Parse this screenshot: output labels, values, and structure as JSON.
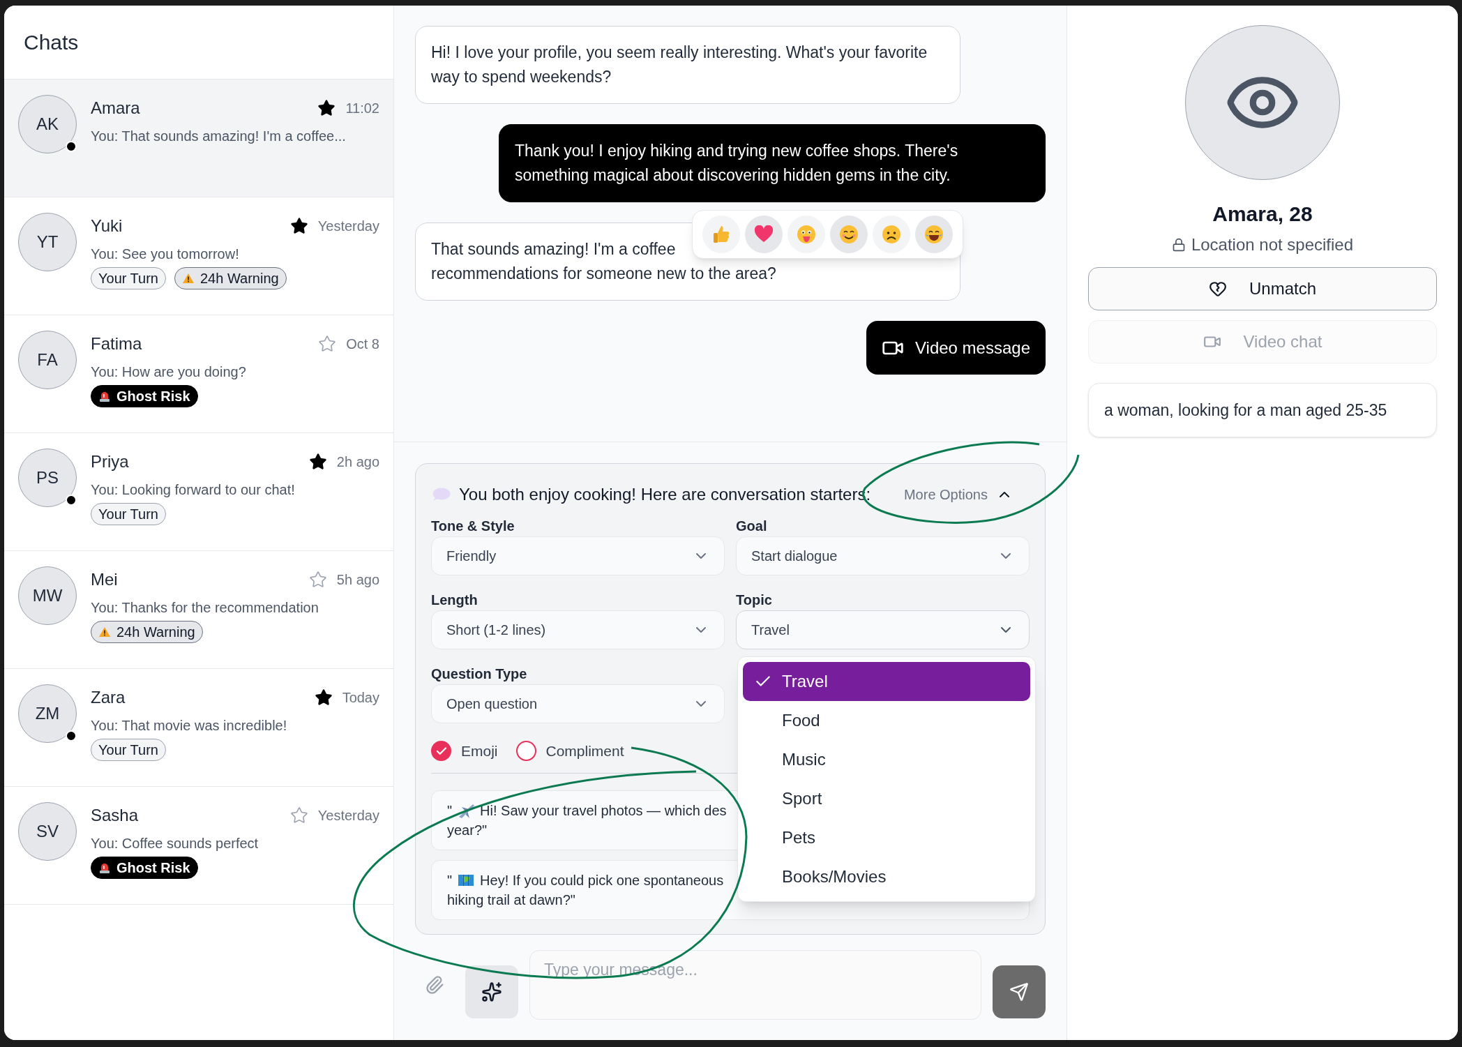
{
  "sidebar": {
    "title": "Chats",
    "chats": [
      {
        "initials": "AK",
        "name": "Amara",
        "time": "11:02",
        "preview": "You: That sounds amazing! I'm a coffee...",
        "starred": true,
        "online": true,
        "selected": true
      },
      {
        "initials": "YT",
        "name": "Yuki",
        "time": "Yesterday",
        "preview": "You: See you tomorrow!",
        "starred": true,
        "online": false,
        "selected": false,
        "badges": [
          {
            "kind": "turn",
            "label": "Your Turn"
          },
          {
            "kind": "warning",
            "label": "24h Warning"
          }
        ]
      },
      {
        "initials": "FA",
        "name": "Fatima",
        "time": "Oct 8",
        "preview": "You: How are you doing?",
        "starred": false,
        "online": false,
        "selected": false,
        "badges": [
          {
            "kind": "ghost",
            "label": "Ghost Risk"
          }
        ]
      },
      {
        "initials": "PS",
        "name": "Priya",
        "time": "2h ago",
        "preview": "You: Looking forward to our chat!",
        "starred": true,
        "online": true,
        "selected": false,
        "badges": [
          {
            "kind": "turn",
            "label": "Your Turn"
          }
        ]
      },
      {
        "initials": "MW",
        "name": "Mei",
        "time": "5h ago",
        "preview": "You: Thanks for the recommendation",
        "starred": false,
        "online": false,
        "selected": false,
        "badges": [
          {
            "kind": "warning",
            "label": "24h Warning"
          }
        ]
      },
      {
        "initials": "ZM",
        "name": "Zara",
        "time": "Today",
        "preview": "You: That movie was incredible!",
        "starred": true,
        "online": true,
        "selected": false,
        "badges": [
          {
            "kind": "turn",
            "label": "Your Turn"
          }
        ]
      },
      {
        "initials": "SV",
        "name": "Sasha",
        "time": "Yesterday",
        "preview": "You: Coffee sounds perfect",
        "starred": false,
        "online": false,
        "selected": false,
        "badges": [
          {
            "kind": "ghost",
            "label": "Ghost Risk"
          }
        ]
      }
    ]
  },
  "chat": {
    "messages": [
      {
        "kind": "received",
        "text": "Hi! I love your profile, you seem really interesting. What's your favorite way to spend weekends?"
      },
      {
        "kind": "sent",
        "text": "Thank you! I enjoy hiking and trying new coffee shops. There's something magical about discovering hidden gems in the city."
      },
      {
        "kind": "received",
        "lines": [
          "That sounds amazing! I'm a coffee",
          "recommendations for someone new to the area?"
        ],
        "reactions": [
          {
            "kind": "thumbs_up",
            "selected": false
          },
          {
            "kind": "heart",
            "selected": true
          },
          {
            "kind": "tongue",
            "selected": false
          },
          {
            "kind": "smile",
            "selected": true
          },
          {
            "kind": "frown",
            "selected": false
          },
          {
            "kind": "laugh",
            "selected": true
          }
        ]
      },
      {
        "kind": "video",
        "text": "Video message"
      }
    ],
    "starters": {
      "title": "You both enjoy cooking! Here are conversation starters:",
      "toggle": {
        "label": "More Options",
        "expanded": true
      },
      "fields": [
        {
          "label": "Tone & Style",
          "value": "Friendly",
          "expanded": false
        },
        {
          "label": "Goal",
          "value": "Start dialogue",
          "expanded": false
        },
        {
          "label": "Length",
          "value": "Short (1-2 lines)",
          "expanded": false
        },
        {
          "label": "Topic",
          "value": "Travel",
          "expanded": true,
          "options": [
            {
              "label": "Travel",
              "selected": true
            },
            {
              "label": "Food",
              "selected": false
            },
            {
              "label": "Music",
              "selected": false
            },
            {
              "label": "Sport",
              "selected": false
            },
            {
              "label": "Pets",
              "selected": false
            },
            {
              "label": "Books/Movies",
              "selected": false
            }
          ]
        },
        {
          "label": "Question Type",
          "value": "Open question",
          "expanded": false
        }
      ],
      "toggles": [
        {
          "label": "Emoji",
          "checked": true
        },
        {
          "label": "Compliment",
          "checked": false
        }
      ],
      "suggestions": [
        {
          "kind": "airplane",
          "quote": "\"",
          "text": "Hi! Saw your travel photos — which des",
          "continuation": "year?\""
        },
        {
          "kind": "map",
          "quote": "\"",
          "text": "Hey! If you could pick one spontaneous",
          "continuation": "hiking trail at dawn?\""
        }
      ]
    },
    "composer": {
      "placeholder": "Type your message...",
      "send_disabled": true
    }
  },
  "profile": {
    "name": "Amara, 28",
    "location": "Location not specified",
    "actions": [
      {
        "kind": "unmatch",
        "label": "Unmatch",
        "disabled": false
      },
      {
        "kind": "video",
        "label": "Video chat",
        "disabled": true
      }
    ],
    "preference": "a woman, looking for a man aged 25-35"
  }
}
